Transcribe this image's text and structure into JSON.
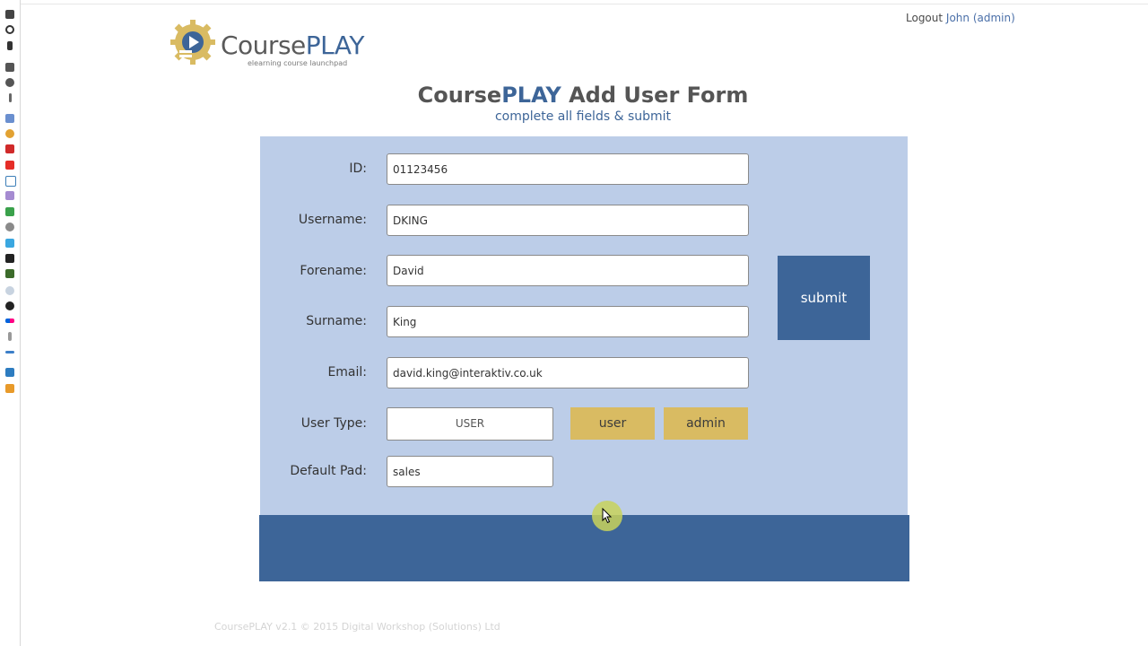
{
  "header": {
    "logout_label": "Logout",
    "user_label": "John (admin)"
  },
  "logo": {
    "word_part1": "Course",
    "word_part2": "PLAY",
    "tagline": "elearning course launchpad"
  },
  "page": {
    "title_part1": "Course",
    "title_part2": "PLAY",
    "title_part3": " Add User Form",
    "subtitle": "complete all fields & submit"
  },
  "form": {
    "id": {
      "label": "ID:",
      "value": "01123456"
    },
    "username": {
      "label": "Username:",
      "value": "DKING"
    },
    "forename": {
      "label": "Forename:",
      "value": "David"
    },
    "surname": {
      "label": "Surname:",
      "value": "King"
    },
    "email": {
      "label": "Email:",
      "value": "david.king@interaktiv.co.uk"
    },
    "user_type": {
      "label": "User Type:",
      "value": "USER",
      "option_user": "user",
      "option_admin": "admin"
    },
    "default_pad": {
      "label": "Default Pad:",
      "value": "sales"
    },
    "submit_label": "submit"
  },
  "footer": {
    "text": "CoursePLAY v2.1 © 2015 Digital Workshop (Solutions) Ltd"
  },
  "colors": {
    "brand_blue": "#3d6598",
    "gold": "#d9bb62",
    "panel": "#bccde8"
  }
}
